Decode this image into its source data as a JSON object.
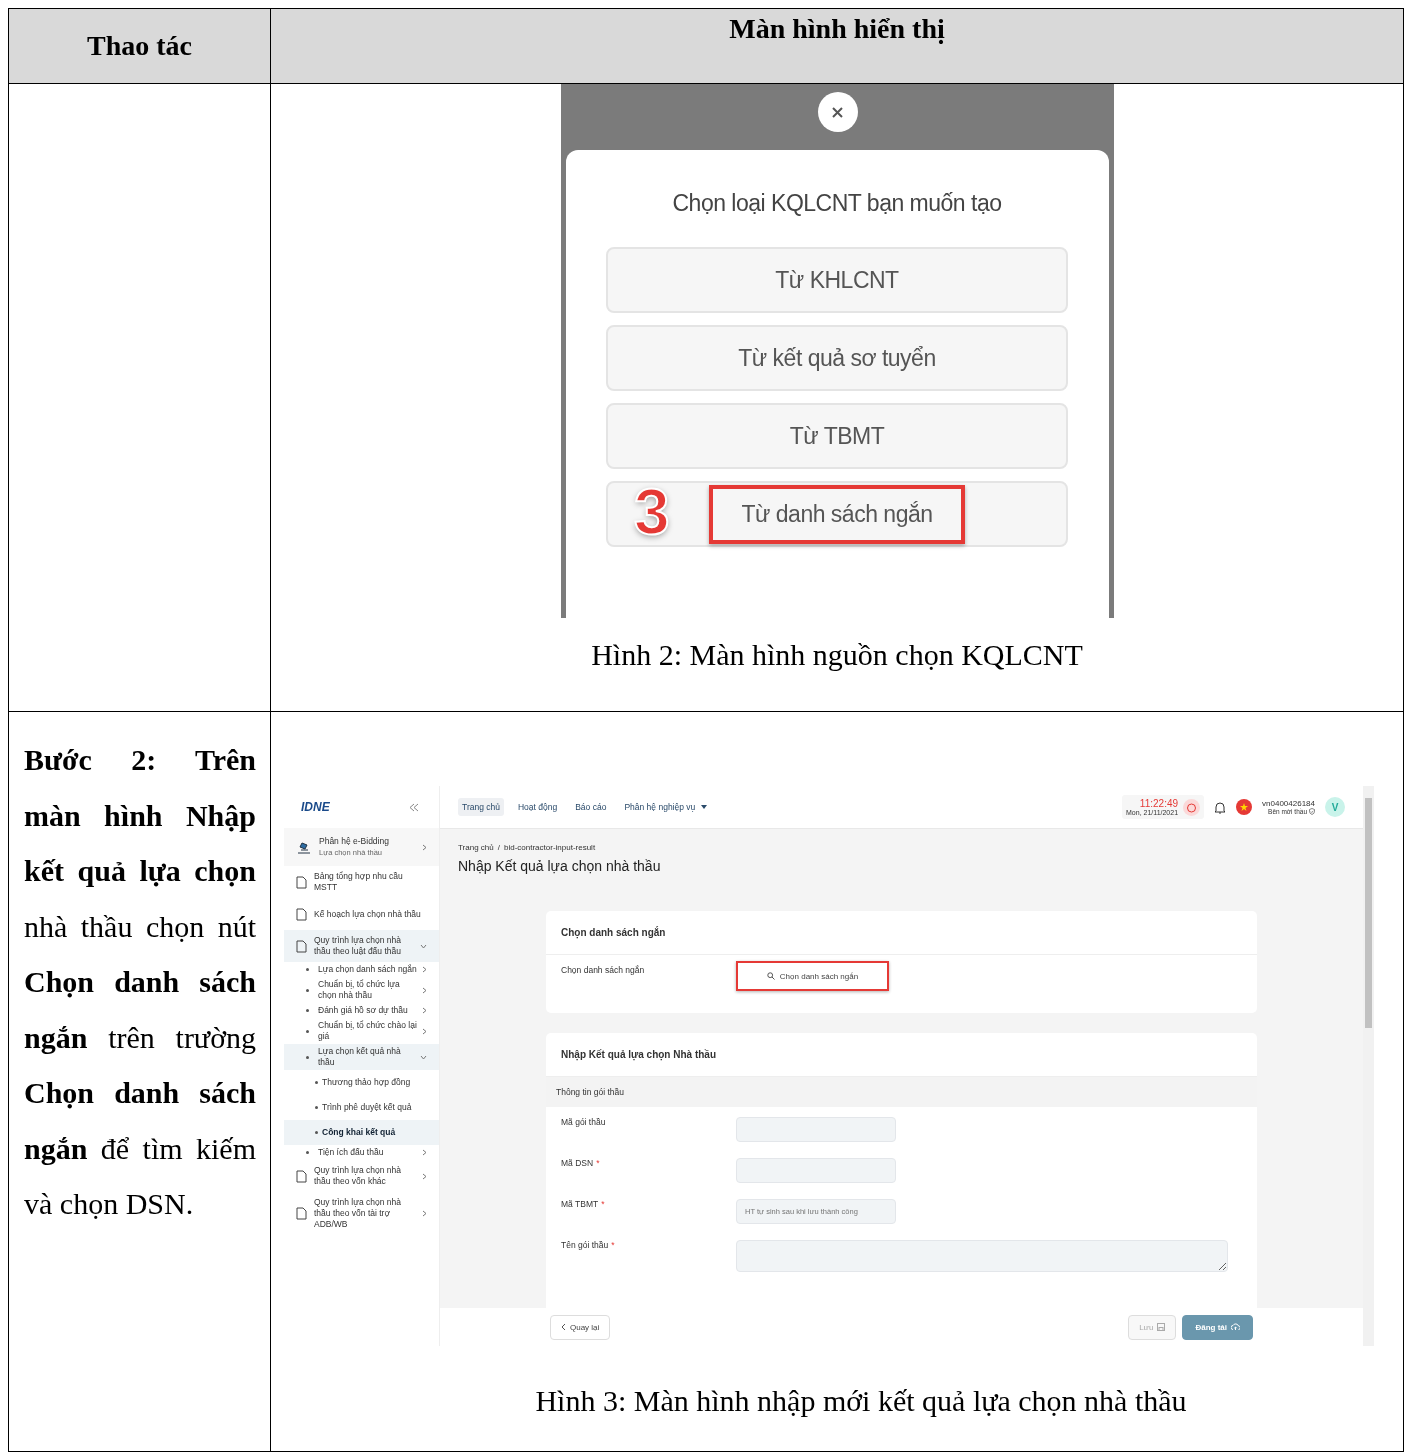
{
  "table": {
    "columns": [
      "Thao tác",
      "Màn hình hiển thị"
    ]
  },
  "figure_2": {
    "dialog": {
      "title": "Chọn loại KQLCNT bạn muốn tạo",
      "options": [
        {
          "label": "Từ KHLCNT",
          "highlighted": false
        },
        {
          "label": "Từ kết quả sơ tuyển",
          "highlighted": false
        },
        {
          "label": "Từ TBMT",
          "highlighted": false
        },
        {
          "label": "Từ danh sách ngắn",
          "highlighted": true
        }
      ],
      "step_marker": "3"
    },
    "caption": "Hình 2: Màn hình nguồn chọn KQLCNT"
  },
  "instruction": "**Bước 2: Trên màn hình Nhập kết quả lựa chọn** nhà thầu chọn nút **Chọn danh sách ngắn** trên trường **Chọn danh sách ngắn** để tìm kiếm và chọn DSN.",
  "figure_3": {
    "logo": "IDNE",
    "sidebar": [
      {
        "kind": "module",
        "title": "Phân hệ e-Bidding",
        "subtitle": "Lựa chọn nhà thầu"
      },
      {
        "kind": "page",
        "title": "Bảng tổng hợp nhu cầu MSTT",
        "expanded": false
      },
      {
        "kind": "page",
        "title": "Kế hoạch lựa chọn nhà thầu",
        "expanded": false
      },
      {
        "kind": "page",
        "title": "Quy trình lựa chọn nhà thầu theo luật đấu thầu",
        "expanded": true,
        "children": [
          {
            "title": "Lựa chọn danh sách ngắn",
            "expanded": false
          },
          {
            "title": "Chuẩn bị, tổ chức lựa chọn nhà thầu",
            "expanded": false
          },
          {
            "title": "Đánh giá hồ sơ dự thầu",
            "expanded": false
          },
          {
            "title": "Chuẩn bị, tổ chức chào lại giá",
            "expanded": false
          },
          {
            "title": "Lựa chọn kết quả nhà thầu",
            "expanded": true,
            "children": [
              {
                "title": "Thương thảo hợp đồng",
                "selected": false
              },
              {
                "title": "Trình phê duyệt kết quả",
                "selected": false
              },
              {
                "title": "Công khai kết quả",
                "selected": true
              }
            ]
          },
          {
            "title": "Tiện ích đấu thầu",
            "expanded": false
          }
        ]
      },
      {
        "kind": "page",
        "title": "Quy trình lựa chọn nhà thầu theo vốn khác",
        "expanded": false
      },
      {
        "kind": "page",
        "title": "Quy trình lựa chọn nhà thầu theo vốn tài trợ ADB/WB",
        "expanded": false
      }
    ],
    "nav": [
      {
        "label": "Trang chủ",
        "selected": true
      },
      {
        "label": "Hoạt động",
        "selected": false
      },
      {
        "label": "Báo cáo",
        "selected": false
      },
      {
        "label": "Phân hệ nghiệp vụ",
        "selected": false,
        "dropdown": true
      }
    ],
    "time": "11:22:49",
    "date": "Mon, 21/11/2021",
    "username": "vn0400426184",
    "role": "Bên mời thầu",
    "avatar": "V",
    "breadcrumb": [
      "Trang chủ",
      "bid-contractor-input-result"
    ],
    "breadcrumb_separator": "/",
    "page_title": "Nhập Kết quả lựa chọn nhà thầu",
    "select_card": {
      "title": "Chọn danh sách ngắn",
      "field_label": "Chọn danh sách ngắn",
      "button_label": "Chọn danh sách ngắn",
      "highlighted": true
    },
    "result_card": {
      "title": "Nhập Kết quả lựa chọn Nhà thầu",
      "required_marker": "*",
      "section": "Thông tin gói thầu",
      "fields": [
        {
          "kind": "input",
          "label": "Mã gói thầu",
          "required": false
        },
        {
          "kind": "input",
          "label": "Mã DSN",
          "required": true
        },
        {
          "kind": "input",
          "label": "Mã TBMT",
          "required": true,
          "placeholder": "HT tự sinh sau khi lưu thành công"
        },
        {
          "kind": "textarea",
          "label": "Tên gói thầu",
          "required": true
        }
      ]
    },
    "footer": {
      "back": "Quay lại",
      "save": "Lưu",
      "publish": "Đăng tải"
    },
    "caption": "Hình 3: Màn hình nhập mới kết quả lựa chọn nhà thầu"
  }
}
